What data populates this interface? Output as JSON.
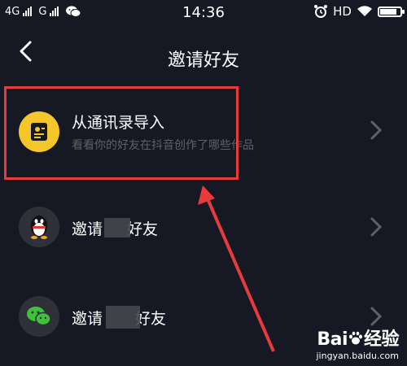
{
  "status_bar": {
    "network_label_1": "4G",
    "network_label_2": "G",
    "time": "14:36",
    "hd_label": "HD",
    "icons": [
      "signal-icon",
      "wechat-icon",
      "alarm-icon",
      "wifi-icon",
      "battery-icon"
    ],
    "battery_level": 0.85
  },
  "nav": {
    "title": "邀请好友",
    "back_icon": "chevron-left-icon"
  },
  "invite_options": [
    {
      "id": "contacts",
      "title": "从通讯录导入",
      "subtitle": "看看你的好友在抖音创作了哪些作品",
      "icon": "contacts-book-icon",
      "icon_color": "#f5c62a"
    },
    {
      "id": "qq",
      "title_prefix": "邀请",
      "title_suffix": "好友",
      "icon": "qq-penguin-icon"
    },
    {
      "id": "wechat",
      "title_prefix": "邀请",
      "title_suffix": "好友",
      "icon": "wechat-icon",
      "icon_color": "#3fc23a"
    }
  ],
  "annotation": {
    "color": "#e83b3b"
  },
  "watermark": {
    "logo_prefix": "Bai",
    "logo_suffix": "经验",
    "url": "jingyan.baidu.com",
    "icon": "baidu-paw-icon"
  },
  "colors": {
    "background": "#161823",
    "avatar_bg": "#2f3038",
    "subtitle": "#5f6069"
  }
}
